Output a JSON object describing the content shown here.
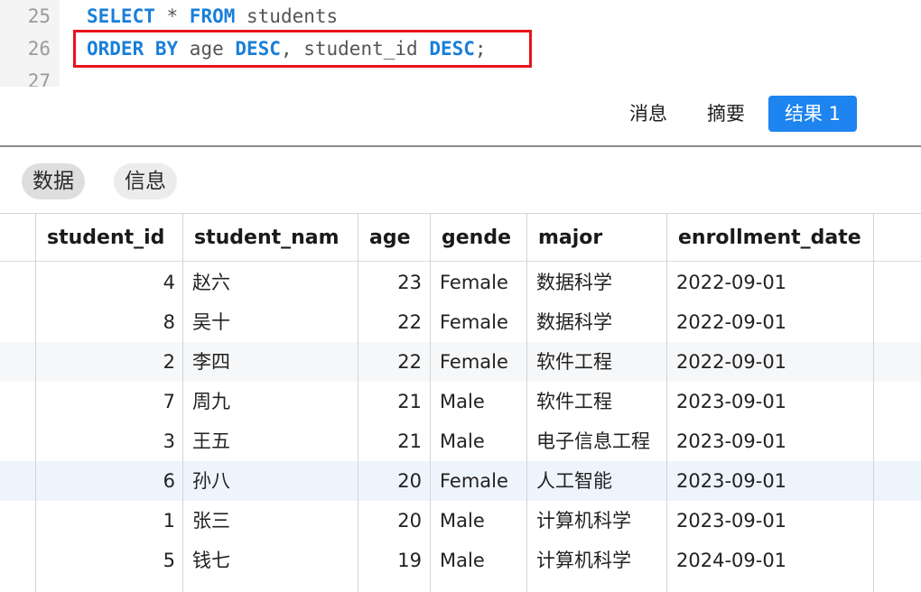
{
  "editor": {
    "lines": [
      {
        "no": "25",
        "tokens": [
          [
            "kw",
            "SELECT"
          ],
          [
            "pl",
            " * "
          ],
          [
            "kw",
            "FROM"
          ],
          [
            "pl",
            " students"
          ]
        ]
      },
      {
        "no": "26",
        "tokens": [
          [
            "kw",
            "ORDER BY"
          ],
          [
            "pl",
            " age "
          ],
          [
            "kw",
            "DESC"
          ],
          [
            "pl",
            ", student_id "
          ],
          [
            "kw",
            "DESC"
          ],
          [
            "pl",
            ";"
          ]
        ]
      },
      {
        "no": "27",
        "tokens": []
      }
    ]
  },
  "result_tabs": {
    "messages": "消息",
    "summary": "摘要",
    "result1": "结果 1"
  },
  "sub_tabs": {
    "data": "数据",
    "info": "信息"
  },
  "table": {
    "columns": [
      "student_id",
      "student_nam",
      "age",
      "gende",
      "major",
      "enrollment_date"
    ],
    "rows": [
      [
        "4",
        "赵六",
        "23",
        "Female",
        "数据科学",
        "2022-09-01"
      ],
      [
        "8",
        "吴十",
        "22",
        "Female",
        "数据科学",
        "2022-09-01"
      ],
      [
        "2",
        "李四",
        "22",
        "Female",
        "软件工程",
        "2022-09-01"
      ],
      [
        "7",
        "周九",
        "21",
        "Male",
        "软件工程",
        "2023-09-01"
      ],
      [
        "3",
        "王五",
        "21",
        "Male",
        "电子信息工程",
        "2023-09-01"
      ],
      [
        "6",
        "孙八",
        "20",
        "Female",
        "人工智能",
        "2023-09-01"
      ],
      [
        "1",
        "张三",
        "20",
        "Male",
        "计算机科学",
        "2023-09-01"
      ],
      [
        "5",
        "钱七",
        "19",
        "Male",
        "计算机科学",
        "2024-09-01"
      ]
    ]
  },
  "colors": {
    "keyword": "#1a7fd8",
    "highlight_border": "#e8141b",
    "active_tab": "#1d84f0"
  }
}
